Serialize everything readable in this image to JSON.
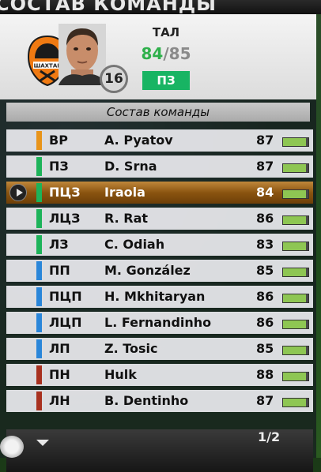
{
  "screen": {
    "title": "СОСТАВ КОМАНДЫ",
    "section_title": "Состав команды",
    "page_indicator": "1/2"
  },
  "player_card": {
    "position": "ТАЛ",
    "rating": "84",
    "rating_separator": "/",
    "potential": "85",
    "number": "16",
    "preferred_position": "ПЗ",
    "club_logo": {
      "text": "ШАХТАР",
      "colors": [
        "#f07a12",
        "#1b1b1b",
        "#ffffff"
      ]
    }
  },
  "colors": {
    "goalkeeper": "#e8941a",
    "defender": "#1db35a",
    "midfielder": "#2a86d9",
    "forward": "#a8311f",
    "fitness": "#8ec653",
    "selected_row": "#8a5410",
    "rating_current": "#2eb04b"
  },
  "roster": [
    {
      "pos": "ВР",
      "name": "A. Pyatov",
      "ovr": "87",
      "group": "goalkeeper",
      "fitness": 0.9
    },
    {
      "pos": "ПЗ",
      "name": "D. Srna",
      "ovr": "87",
      "group": "defender",
      "fitness": 0.9
    },
    {
      "pos": "ПЦЗ",
      "name": "Iraola",
      "ovr": "84",
      "group": "defender",
      "fitness": 0.9,
      "selected": true
    },
    {
      "pos": "ЛЦЗ",
      "name": "R. Rat",
      "ovr": "86",
      "group": "defender",
      "fitness": 0.9
    },
    {
      "pos": "ЛЗ",
      "name": "C. Odiah",
      "ovr": "83",
      "group": "defender",
      "fitness": 0.9
    },
    {
      "pos": "ПП",
      "name": "M. González",
      "ovr": "85",
      "group": "midfielder",
      "fitness": 0.9
    },
    {
      "pos": "ПЦП",
      "name": "H. Mkhitaryan",
      "ovr": "86",
      "group": "midfielder",
      "fitness": 0.9
    },
    {
      "pos": "ЛЦП",
      "name": "L. Fernandinho",
      "ovr": "86",
      "group": "midfielder",
      "fitness": 0.9
    },
    {
      "pos": "ЛП",
      "name": "Z. Tosic",
      "ovr": "85",
      "group": "midfielder",
      "fitness": 0.9
    },
    {
      "pos": "ПН",
      "name": "Hulk",
      "ovr": "88",
      "group": "forward",
      "fitness": 0.9
    },
    {
      "pos": "ЛН",
      "name": "B. Dentinho",
      "ovr": "87",
      "group": "forward",
      "fitness": 0.9
    }
  ]
}
